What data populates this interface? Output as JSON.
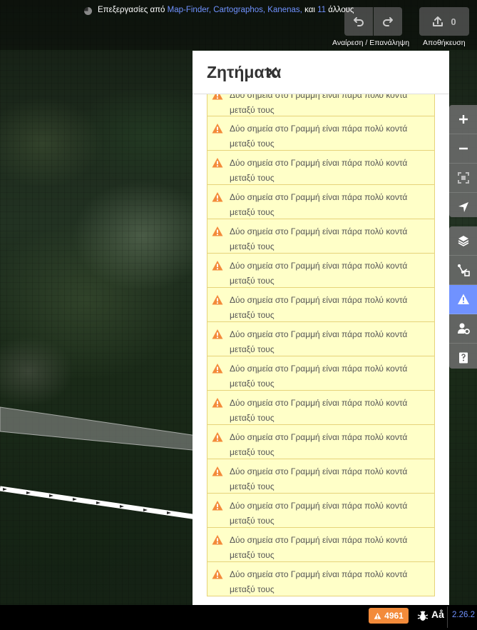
{
  "toolbar": {
    "undo_redo_label": "Αναίρεση / Επανάληψη",
    "save_label": "Αποθήκευση",
    "save_count": "0"
  },
  "panel": {
    "title": "Ζητήματα",
    "close_label": "✕"
  },
  "issues": [
    {
      "message": "Δύο σημεία στο Γραμμή είναι πάρα πολύ κοντά μεταξύ τους"
    },
    {
      "message": "Δύο σημεία στο Γραμμή είναι πάρα πολύ κοντά μεταξύ τους"
    },
    {
      "message": "Δύο σημεία στο Γραμμή είναι πάρα πολύ κοντά μεταξύ τους"
    },
    {
      "message": "Δύο σημεία στο Γραμμή είναι πάρα πολύ κοντά μεταξύ τους"
    },
    {
      "message": "Δύο σημεία στο Γραμμή είναι πάρα πολύ κοντά μεταξύ τους"
    },
    {
      "message": "Δύο σημεία στο Γραμμή είναι πάρα πολύ κοντά μεταξύ τους"
    },
    {
      "message": "Δύο σημεία στο Γραμμή είναι πάρα πολύ κοντά μεταξύ τους"
    },
    {
      "message": "Δύο σημεία στο Γραμμή είναι πάρα πολύ κοντά μεταξύ τους"
    },
    {
      "message": "Δύο σημεία στο Γραμμή είναι πάρα πολύ κοντά μεταξύ τους"
    },
    {
      "message": "Δύο σημεία στο Γραμμή είναι πάρα πολύ κοντά μεταξύ τους"
    },
    {
      "message": "Δύο σημεία στο Γραμμή είναι πάρα πολύ κοντά μεταξύ τους"
    },
    {
      "message": "Δύο σημεία στο Γραμμή είναι πάρα πολύ κοντά μεταξύ τους"
    },
    {
      "message": "Δύο σημεία στο Γραμμή είναι πάρα πολύ κοντά μεταξύ τους"
    },
    {
      "message": "Δύο σημεία στο Γραμμή είναι πάρα πολύ κοντά μεταξύ τους"
    },
    {
      "message": "Δύο σημεία στο Γραμμή είναι πάρα πολύ κοντά μεταξύ τους"
    }
  ],
  "map_controls": {
    "zoom_in_icon": "plus-icon",
    "zoom_out_icon": "minus-icon",
    "zoom_to_selection_icon": "frame-icon",
    "geolocate_icon": "location-arrow-icon",
    "background_icon": "layers-icon",
    "map_data_icon": "map-data-icon",
    "issues_icon": "warning-icon",
    "preferences_icon": "user-gear-icon",
    "help_icon": "help-book-icon",
    "active_color": "#7092ff"
  },
  "footer": {
    "edits_prefix": "Επεξεργασίες από",
    "contributors": "Map-Finder, Cartographos, Kanenas,",
    "and_label": "και",
    "others_count": "11",
    "others_label": "άλλους",
    "issues_count": "4961",
    "a11y_label": "Aå",
    "version": "2.26.2"
  },
  "colors": {
    "issue_bg": "#ffffc8",
    "issue_border": "#e6d37a",
    "warning": "#f38b3a",
    "link": "#7092ff"
  }
}
